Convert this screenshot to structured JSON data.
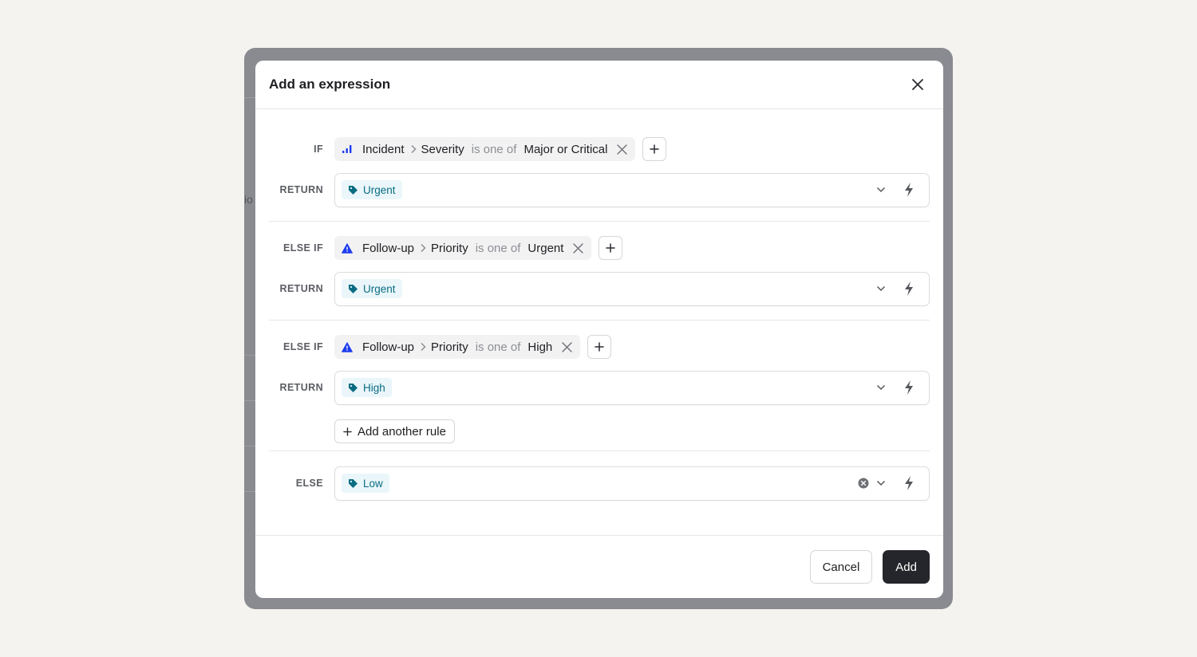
{
  "background_fragment": "io",
  "modal": {
    "title": "Add an expression",
    "close_icon": "close-icon"
  },
  "rules": [
    {
      "keyword": "IF",
      "condition": {
        "icon": "severity-bars-icon",
        "subject": "Incident",
        "field": "Severity",
        "operator": "is one of",
        "value": "Major or Critical"
      },
      "return_label": "RETURN",
      "return_value": "Urgent"
    },
    {
      "keyword": "ELSE IF",
      "condition": {
        "icon": "warning-triangle-icon",
        "subject": "Follow-up",
        "field": "Priority",
        "operator": "is one of",
        "value": "Urgent"
      },
      "return_label": "RETURN",
      "return_value": "Urgent"
    },
    {
      "keyword": "ELSE IF",
      "condition": {
        "icon": "warning-triangle-icon",
        "subject": "Follow-up",
        "field": "Priority",
        "operator": "is one of",
        "value": "High"
      },
      "return_label": "RETURN",
      "return_value": "High"
    }
  ],
  "add_rule_label": "Add another rule",
  "else": {
    "keyword": "ELSE",
    "value": "Low"
  },
  "footer": {
    "cancel_label": "Cancel",
    "add_label": "Add"
  },
  "colors": {
    "tag_bg": "#eaf6fa",
    "tag_text": "#0a6c83",
    "condition_icon": "#1e3df0",
    "primary_button": "#25262b"
  }
}
